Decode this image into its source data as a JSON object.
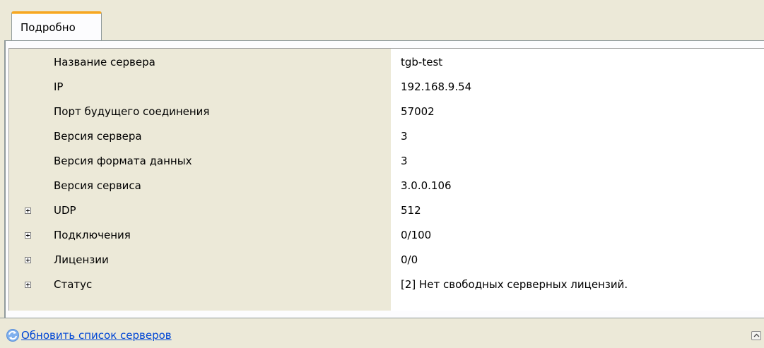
{
  "tabs": [
    {
      "label": "Подробно"
    }
  ],
  "properties": [
    {
      "label": "Название сервера",
      "value": "tgb-test",
      "expandable": false
    },
    {
      "label": "IP",
      "value": "192.168.9.54",
      "expandable": false
    },
    {
      "label": "Порт будущего соединения",
      "value": "57002",
      "expandable": false
    },
    {
      "label": "Версия сервера",
      "value": "3",
      "expandable": false
    },
    {
      "label": "Версия формата данных",
      "value": "3",
      "expandable": false
    },
    {
      "label": "Версия сервиса",
      "value": "3.0.0.106",
      "expandable": false
    },
    {
      "label": "UDP",
      "value": "512",
      "expandable": true
    },
    {
      "label": "Подключения",
      "value": "0/100",
      "expandable": true
    },
    {
      "label": "Лицензии",
      "value": "0/0",
      "expandable": true
    },
    {
      "label": "Статус",
      "value": "[2] Нет свободных серверных лицензий.",
      "expandable": true
    }
  ],
  "footer": {
    "refresh_link": "Обновить список серверов"
  },
  "colors": {
    "link": "#0046d5",
    "tab_accent": "#f5a623",
    "background": "#ece9d8"
  }
}
